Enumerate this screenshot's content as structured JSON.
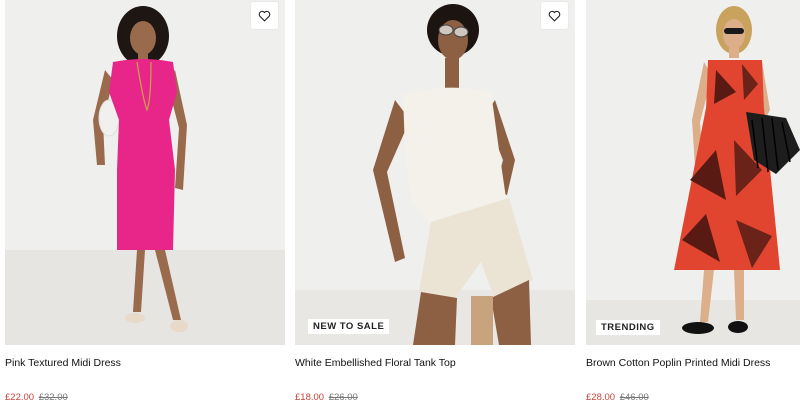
{
  "products": [
    {
      "name": "Pink Textured Midi Dress",
      "price_now": "£22.00",
      "price_was": "£32.00",
      "badge": "",
      "colors": {
        "garment": "#e8268a",
        "skin": "#9a6a4c",
        "hair": "#1d1612"
      }
    },
    {
      "name": "White Embellished Floral Tank Top",
      "price_now": "£18.00",
      "price_was": "£26.00",
      "badge": "NEW TO SALE",
      "colors": {
        "garment": "#f3f1ea",
        "skin": "#8d5f43",
        "hair": "#1b1410"
      }
    },
    {
      "name": "Brown Cotton Poplin Printed Midi Dress",
      "price_now": "£28.00",
      "price_was": "£46.00",
      "badge": "TRENDING",
      "colors": {
        "garment": "#e2452f",
        "skin": "#dcae8a",
        "hair": "#c9a25e"
      }
    }
  ],
  "icons": {
    "wishlist": "heart-outline-icon"
  },
  "theme": {
    "sale_price": "#c8423b",
    "was_price": "#777777",
    "image_bg": "#efefed"
  }
}
